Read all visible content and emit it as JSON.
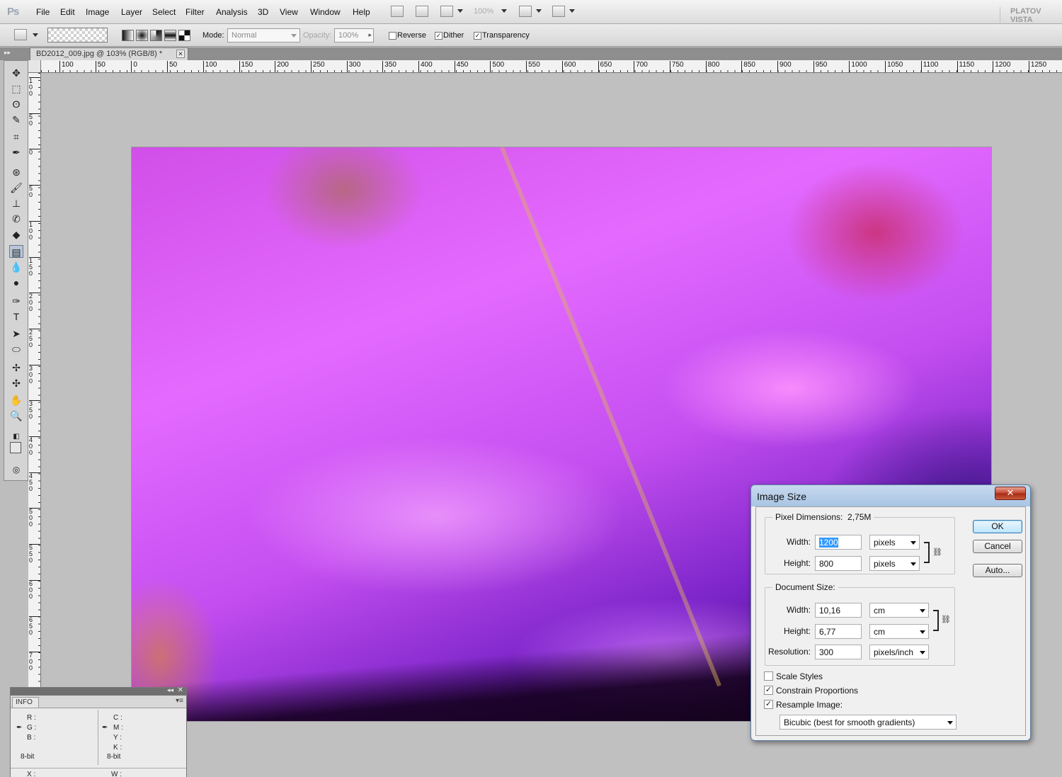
{
  "app": {
    "logo": "Ps",
    "menu": [
      "File",
      "Edit",
      "Image",
      "Layer",
      "Select",
      "Filter",
      "Analysis",
      "3D",
      "View",
      "Window",
      "Help"
    ],
    "zoom": "100%",
    "workspace": "PLATOV VISTA"
  },
  "options": {
    "mode_label": "Mode:",
    "mode_value": "Normal",
    "opacity_label": "Opacity:",
    "opacity_value": "100%",
    "reverse_label": "Reverse",
    "dither_label": "Dither",
    "transparency_label": "Transparency",
    "reverse_checked": false,
    "dither_checked": true,
    "transparency_checked": true
  },
  "document": {
    "tab_title": "BD2012_009.jpg @ 103% (RGB/8) *",
    "close_glyph": "✕"
  },
  "rulers": {
    "horizontal": [
      "100",
      "50",
      "0",
      "50",
      "100",
      "150",
      "200",
      "250",
      "300",
      "350",
      "400",
      "450",
      "500",
      "550",
      "600",
      "650",
      "700",
      "750",
      "800",
      "850",
      "900",
      "950",
      "1000",
      "1050",
      "1100",
      "1150",
      "1200",
      "1250"
    ],
    "vertical": [
      "100",
      "50",
      "0",
      "50",
      "100",
      "150",
      "200",
      "250",
      "300",
      "350",
      "400",
      "450",
      "500",
      "550",
      "600",
      "650",
      "700"
    ]
  },
  "tools": [
    "move-icon",
    "marquee-icon",
    "lasso-icon",
    "quick-select-icon",
    "crop-icon",
    "eyedropper-icon",
    "spot-heal-icon",
    "brush-icon",
    "clone-stamp-icon",
    "history-brush-icon",
    "eraser-icon",
    "gradient-icon",
    "blur-icon",
    "dodge-icon",
    "pen-icon",
    "type-icon",
    "path-select-icon",
    "shape-icon",
    "3d-rotate-icon",
    "3d-orbit-icon",
    "hand-icon",
    "zoom-icon"
  ],
  "tool_glyphs": [
    "✥",
    "⬚",
    "ʘ",
    "✎",
    "⌗",
    "✒",
    "⊛",
    "🖌",
    "⊥",
    "✆",
    "◆",
    "▤",
    "💧",
    "●",
    "✑",
    "T",
    "➤",
    "⬭",
    "✢",
    "✣",
    "✋",
    "🔍"
  ],
  "info_panel": {
    "tab": "INFO",
    "labels_left": [
      "R :",
      "G :",
      "B :"
    ],
    "labels_right": [
      "C :",
      "M :",
      "Y :",
      "K :"
    ],
    "bit_left": "8-bit",
    "bit_right": "8-bit",
    "x_label": "X :",
    "w_label": "W :"
  },
  "dialog": {
    "title": "Image Size",
    "close_glyph": "✕",
    "pixel_dimensions_label": "Pixel Dimensions:",
    "pixel_dimensions_value": "2,75M",
    "pd_width_label": "Width:",
    "pd_width_value": "1200",
    "pd_width_unit": "pixels",
    "pd_height_label": "Height:",
    "pd_height_value": "800",
    "pd_height_unit": "pixels",
    "document_size_label": "Document Size:",
    "ds_width_label": "Width:",
    "ds_width_value": "10,16",
    "ds_width_unit": "cm",
    "ds_height_label": "Height:",
    "ds_height_value": "6,77",
    "ds_height_unit": "cm",
    "resolution_label": "Resolution:",
    "resolution_value": "300",
    "resolution_unit": "pixels/inch",
    "scale_styles_label": "Scale Styles",
    "constrain_label": "Constrain Proportions",
    "resample_label": "Resample Image:",
    "scale_styles_checked": false,
    "constrain_checked": true,
    "resample_checked": true,
    "resample_method": "Bicubic (best for smooth gradients)",
    "ok_label": "OK",
    "cancel_label": "Cancel",
    "auto_label": "Auto..."
  }
}
